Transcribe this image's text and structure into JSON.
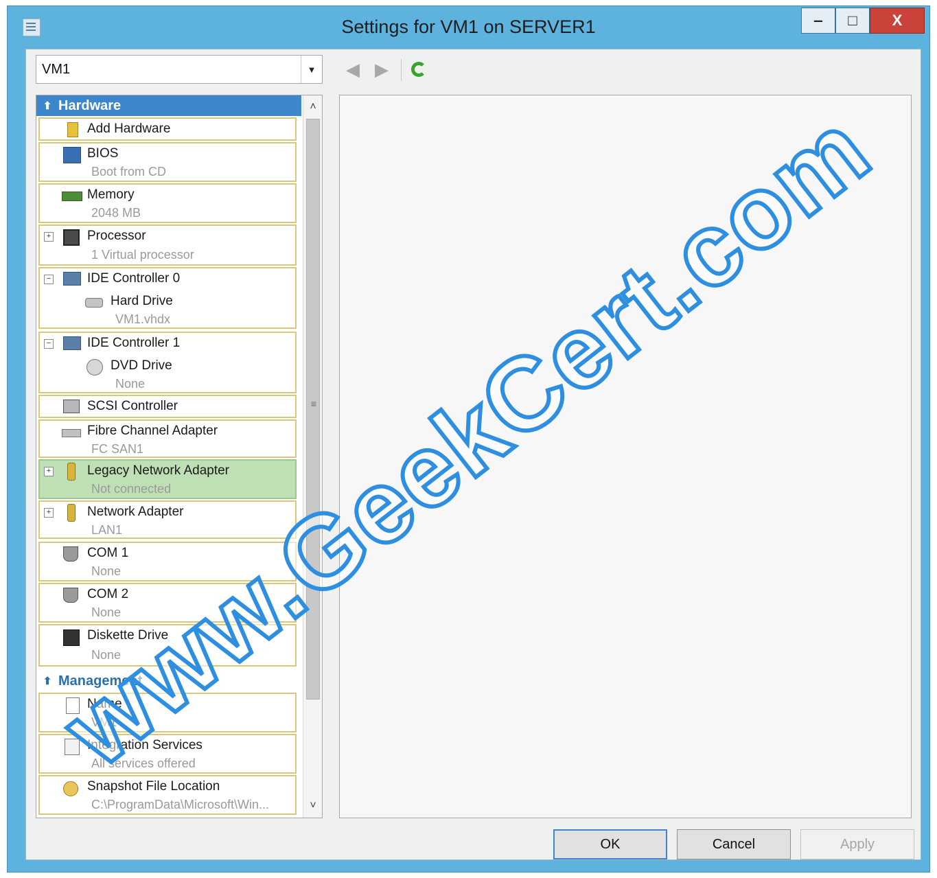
{
  "window": {
    "title": "Settings for VM1 on SERVER1",
    "minimize_glyph": "‒",
    "maximize_glyph": "□",
    "close_glyph": "X"
  },
  "vm_selector": {
    "value": "VM1",
    "arrow": "▼"
  },
  "nav": {
    "back": "◀",
    "forward": "▶"
  },
  "tree": {
    "hardware": {
      "title": "Hardware",
      "collapse_glyph": "⬆",
      "items": [
        {
          "label": "Add Hardware"
        },
        {
          "label": "BIOS",
          "sub": "Boot from CD"
        },
        {
          "label": "Memory",
          "sub": "2048 MB"
        },
        {
          "label": "Processor",
          "sub": "1 Virtual processor",
          "expander": "+"
        },
        {
          "label": "IDE Controller 0",
          "expander": "−",
          "child": {
            "label": "Hard Drive",
            "sub": "VM1.vhdx"
          }
        },
        {
          "label": "IDE Controller 1",
          "expander": "−",
          "child": {
            "label": "DVD Drive",
            "sub": "None"
          }
        },
        {
          "label": "SCSI Controller"
        },
        {
          "label": "Fibre Channel Adapter",
          "sub": "FC SAN1"
        },
        {
          "label": "Legacy Network Adapter",
          "sub": "Not connected",
          "expander": "+"
        },
        {
          "label": "Network Adapter",
          "sub": "LAN1",
          "expander": "+"
        },
        {
          "label": "COM 1",
          "sub": "None"
        },
        {
          "label": "COM 2",
          "sub": "None"
        },
        {
          "label": "Diskette Drive",
          "sub": "None"
        }
      ]
    },
    "management": {
      "title": "Management",
      "collapse_glyph": "⬆",
      "items": [
        {
          "label": "Name",
          "sub": "VM1"
        },
        {
          "label": "Integration Services",
          "sub": "All services offered"
        },
        {
          "label": "Snapshot File Location",
          "sub": "C:\\ProgramData\\Microsoft\\Win..."
        }
      ]
    },
    "scroll_up": "˄",
    "scroll_down": "˅",
    "scroll_grip": "≡"
  },
  "buttons": {
    "ok": "OK",
    "cancel": "Cancel",
    "apply": "Apply"
  },
  "watermark": "www.GeekCert.com",
  "colors": {
    "window_frame": "#5eb3de",
    "hardware_header": "#3d86cc",
    "selected_item": "#bfe0b4",
    "item_border": "#d9c77a",
    "watermark_stroke": "#2e8fe0"
  }
}
